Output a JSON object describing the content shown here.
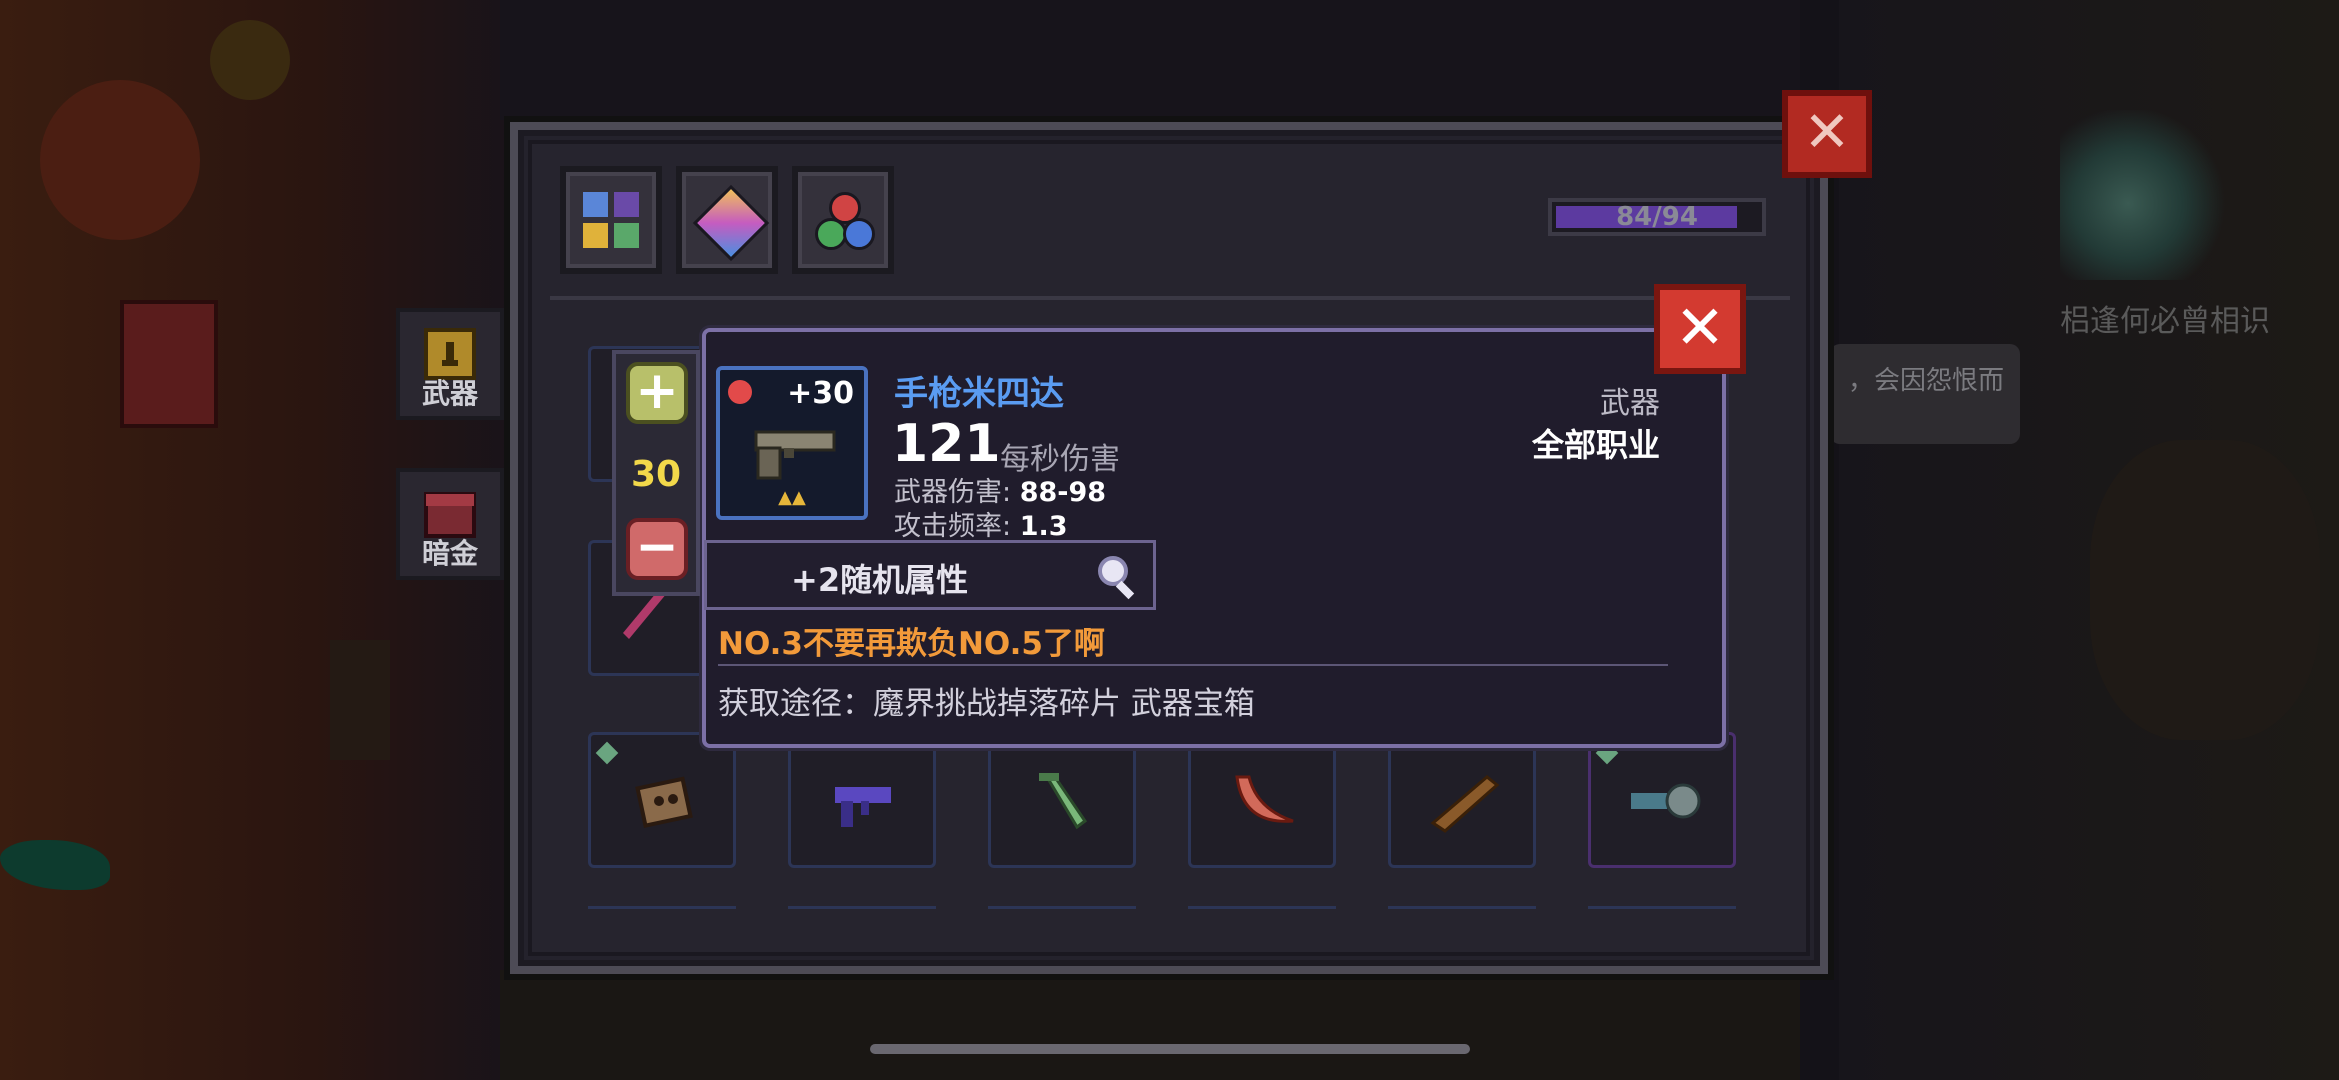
{
  "background": {
    "npc_caption": "梠逢何必曾相识",
    "npc_bubble": "，会因怨恨而"
  },
  "backpack": {
    "tabs": [
      {
        "name": "color-grid-tab",
        "icon": "color-grid-icon"
      },
      {
        "name": "gem-tab",
        "icon": "diamond-gem-icon"
      },
      {
        "name": "orb-tab",
        "icon": "colored-orbs-icon"
      }
    ],
    "capacity_text": "84/94",
    "capacity_fraction": 0.894,
    "side_tabs": [
      {
        "label": "武器",
        "icon": "weapon-chest-icon"
      },
      {
        "label": "暗金",
        "icon": "dark-gold-chest-icon"
      }
    ],
    "close_icon": "close-icon"
  },
  "tooltip": {
    "quantity": "30",
    "plus_symbol": "+",
    "minus_symbol": "−",
    "close_symbol": "✕",
    "item": {
      "level": "+30",
      "name": "手枪米四达",
      "dps_value": "121",
      "dps_label": "每秒伤害",
      "damage_label": "武器伤害:",
      "damage_value": "88-98",
      "rate_label": "攻击频率:",
      "rate_value": "1.3",
      "type": "武器",
      "class": "全部职业",
      "stars": "▲▲",
      "icon": "pistol-icon"
    },
    "random_attr": "+2随机属性",
    "flavor": "NO.3不要再欺负NO.5了啊",
    "source": "获取途径：魔界挑战掉落碎片 武器宝箱"
  },
  "colors": {
    "accent_blue": "#5a9cf2",
    "flavor_orange": "#f29a3a",
    "quantity_yellow": "#f2d84a",
    "close_red": "#d33a30"
  }
}
